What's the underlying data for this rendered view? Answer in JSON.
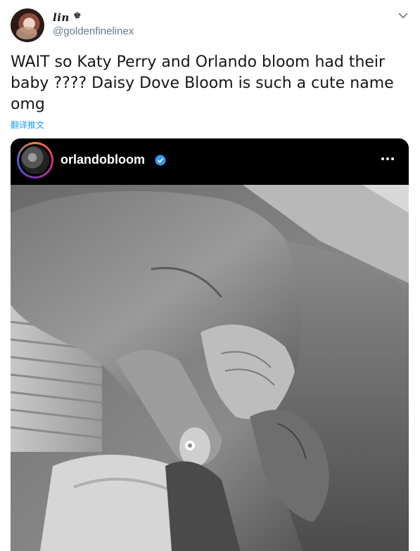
{
  "tweet": {
    "author": {
      "display_name": "lin",
      "name_emoji": "♚",
      "handle": "@goldenfinelinex"
    },
    "text": "WAIT so Katy Perry and Orlando bloom had their\nbaby ???? Daisy Dove Bloom is such a cute name\nomg",
    "translate_label": "翻译推文"
  },
  "embedded_post": {
    "username": "orlandobloom",
    "verified": true,
    "verified_color": "#3897f0",
    "more_icon": "more-horizontal-icon",
    "photo_description_icon": "photo"
  },
  "colors": {
    "link": "#1da1f2",
    "text": "#14171a",
    "secondary": "#657786"
  }
}
